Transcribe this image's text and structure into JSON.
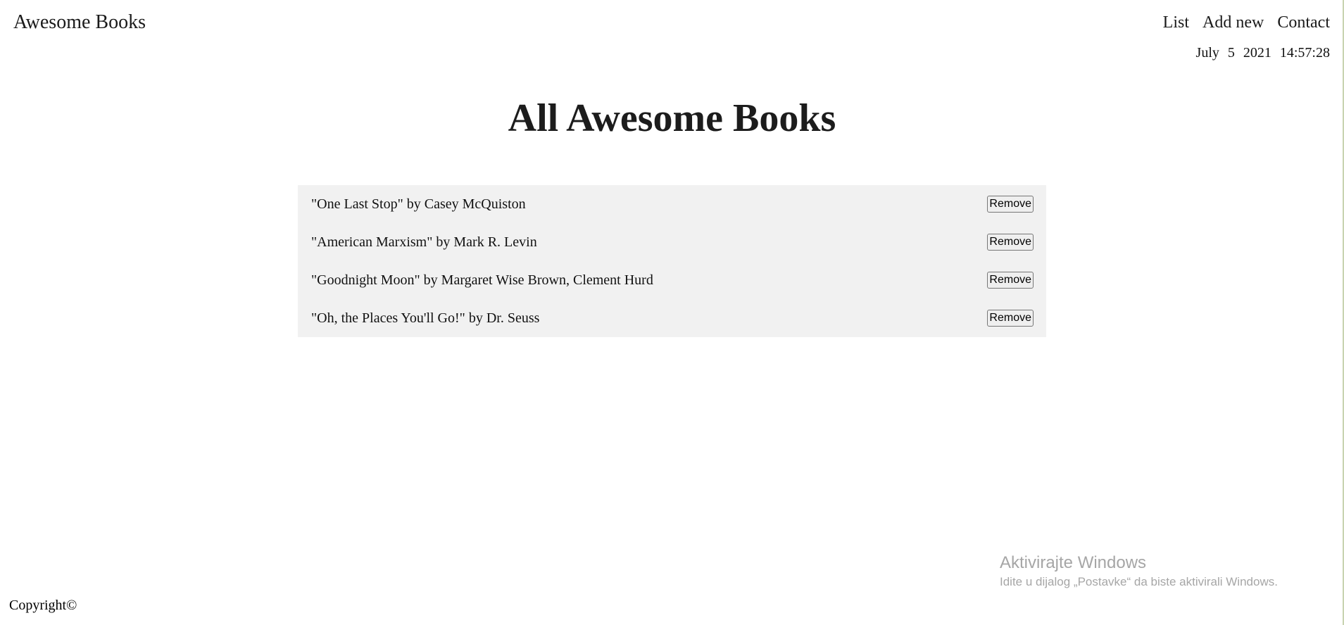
{
  "header": {
    "brand": "Awesome Books",
    "nav": [
      {
        "label": "List"
      },
      {
        "label": "Add new"
      },
      {
        "label": "Contact"
      }
    ],
    "date": {
      "month": "July",
      "day": "5",
      "year": "2021",
      "time": "14:57:28"
    }
  },
  "main": {
    "title": "All Awesome Books",
    "books": [
      {
        "text": "\"One Last Stop\" by Casey McQuiston",
        "button": "Remove"
      },
      {
        "text": "\"American Marxism\" by Mark R. Levin",
        "button": "Remove"
      },
      {
        "text": "\"Goodnight Moon\" by Margaret Wise Brown, Clement Hurd",
        "button": "Remove"
      },
      {
        "text": "\"Oh, the Places You'll Go!\" by Dr. Seuss",
        "button": "Remove"
      }
    ]
  },
  "watermark": {
    "title": "Aktivirajte Windows",
    "subtitle": "Idite u dijalog „Postavke“ da biste aktivirali Windows."
  },
  "footer": {
    "copyright": "Copyright©"
  }
}
